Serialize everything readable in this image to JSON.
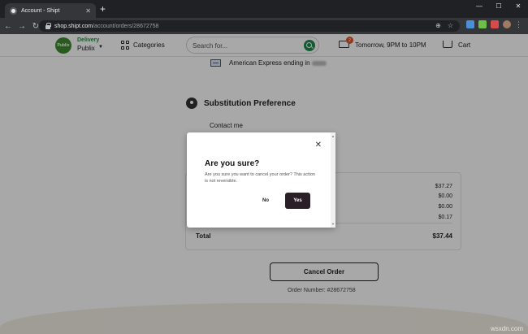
{
  "browser": {
    "tab_title": "Account - Shipt",
    "url_host": "shop.shipt.com",
    "url_path": "/account/orders/28672758"
  },
  "header": {
    "store_logo_text": "Publix",
    "delivery_label": "Delivery",
    "store_name": "Publix",
    "categories_label": "Categories",
    "search_placeholder": "Search for...",
    "cart_count": "2",
    "delivery_time": "Tomorrow, 9PM to 10PM",
    "cart_label": "Cart"
  },
  "order": {
    "payment_text": "American Express ending in",
    "substitution_title": "Substitution Preference",
    "substitution_value": "Contact me",
    "summary_values": [
      "$37.27",
      "$0.00",
      "$0.00",
      "$0.17"
    ],
    "total_label": "Total",
    "total_value": "$37.44",
    "cancel_label": "Cancel Order",
    "order_number": "Order Number: #28672758"
  },
  "modal": {
    "title": "Are you sure?",
    "message": "Are you sure you want to cancel your order? This action is not reversible.",
    "no_label": "No",
    "yes_label": "Yes"
  },
  "watermark": "wsxdn.com",
  "colors": {
    "brand_green": "#1f8a4c",
    "badge": "#e1532b",
    "yes_button": "#2a1f26"
  }
}
